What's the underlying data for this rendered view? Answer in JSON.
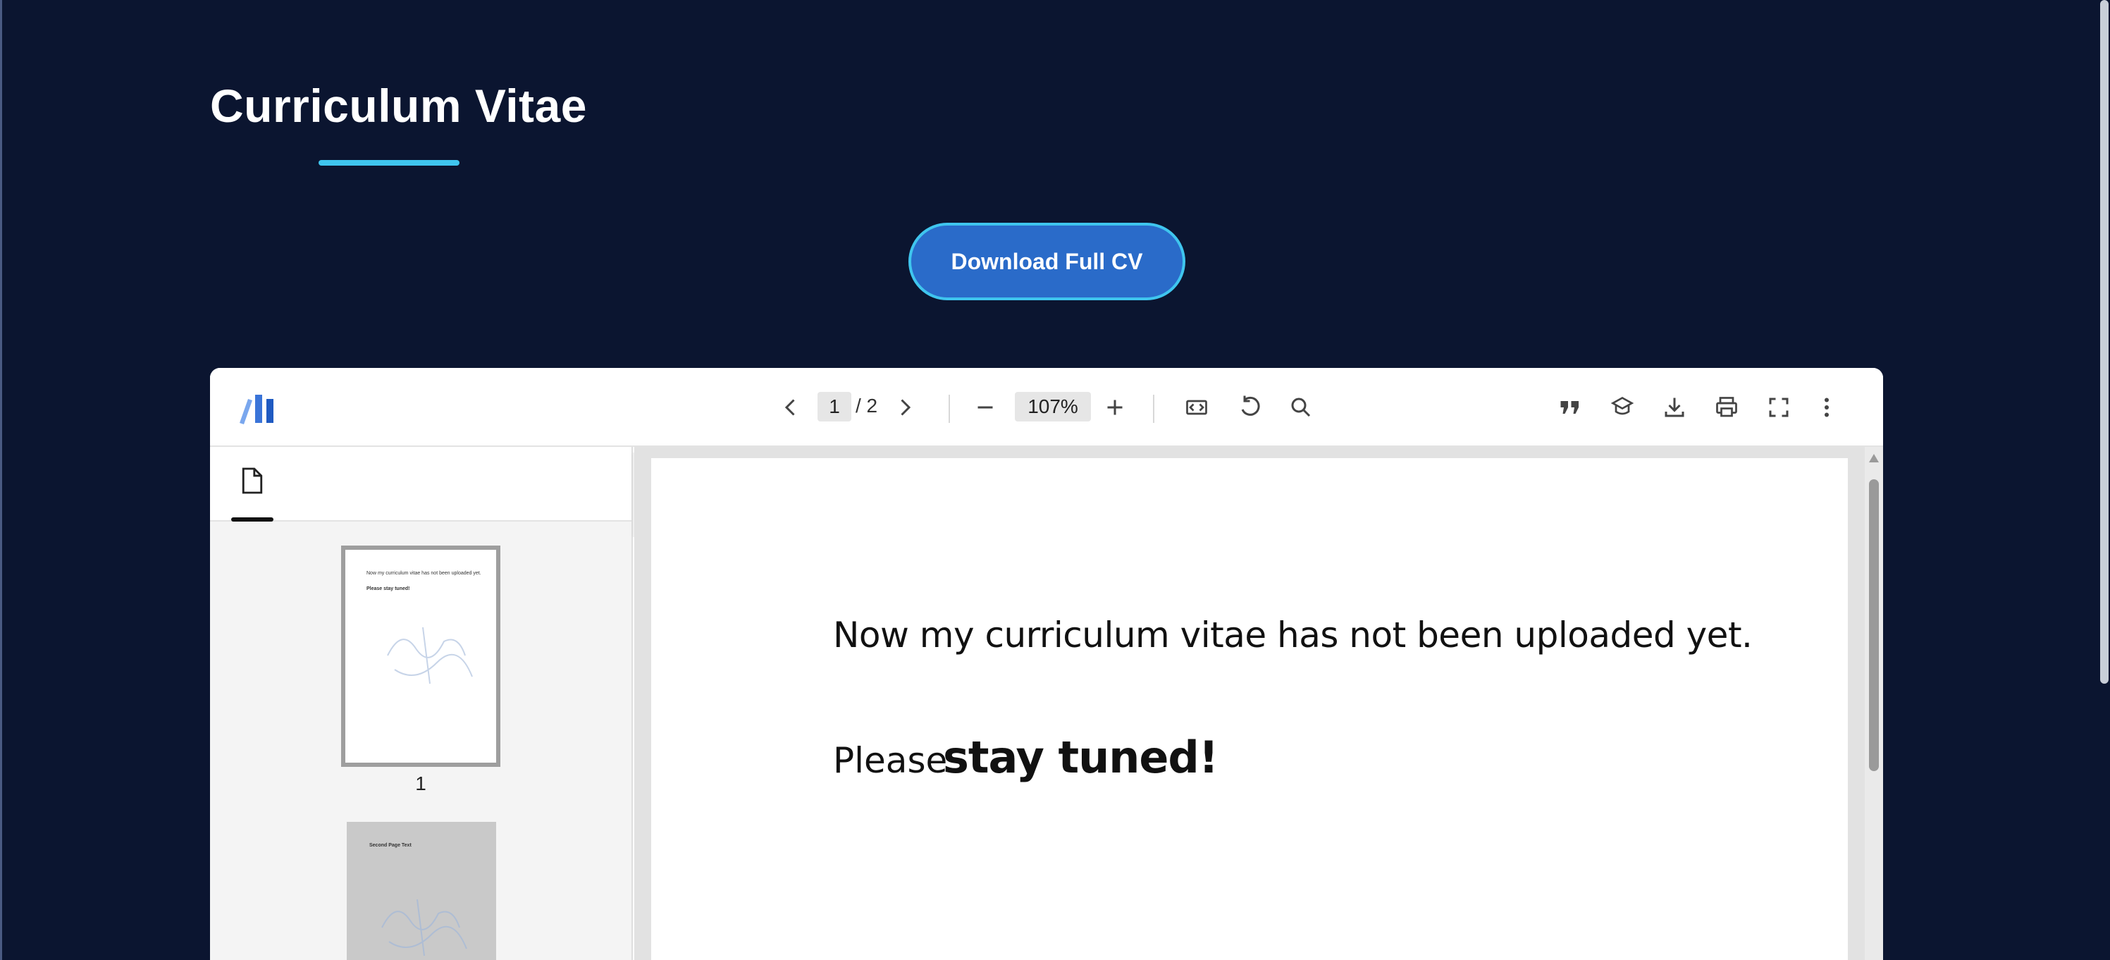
{
  "page": {
    "title": "Curriculum Vitae",
    "download_label": "Download Full CV"
  },
  "viewer": {
    "current_page": "1",
    "total_pages": "/ 2",
    "zoom": "107%",
    "thumbnail_label": "1",
    "document": {
      "line1": "Now my curriculum vitae has not been uploaded yet.",
      "line2_prefix": "Please",
      "line2_bold": "stay tuned!"
    },
    "thumb1_text": {
      "line1": "Now my curriculum vitae has not been uploaded yet.",
      "line2": "Please stay tuned!"
    },
    "thumb2_text": "Second Page Text"
  },
  "icons": {
    "logo": "viewer-logo",
    "prev": "chevron-left-icon",
    "next": "chevron-right-icon",
    "zoom_out": "minus-icon",
    "zoom_in": "plus-icon",
    "fit": "fit-width-icon",
    "rotate": "rotate-icon",
    "search": "search-icon",
    "quote": "quote-icon",
    "cite": "cite-icon",
    "download": "download-icon",
    "print": "print-icon",
    "fullscreen": "fullscreen-icon",
    "more": "more-vertical-icon",
    "thumbnails": "document-icon",
    "collapse": "chevron-left-icon"
  },
  "colors": {
    "background": "#0b1530",
    "accent": "#3fc5ee",
    "button": "#2a6bc9"
  }
}
